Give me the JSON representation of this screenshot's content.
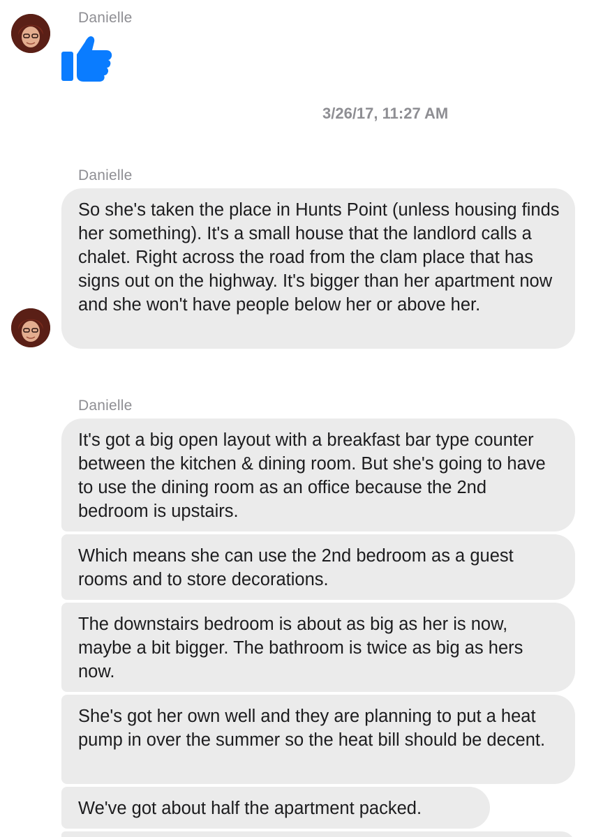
{
  "thread": {
    "sender_name": "Danielle",
    "timestamp": "3/26/17, 11:27 AM",
    "groups": [
      {
        "sender": "Danielle",
        "messages": [
          {
            "type": "like",
            "icon": "thumbs-up-icon"
          }
        ]
      },
      {
        "sender": "Danielle",
        "messages": [
          {
            "type": "text",
            "text": "So she's taken the place in Hunts Point (unless housing finds her something). It's a small house that the landlord calls a chalet. Right across the road from the clam place that has signs out on the highway. It's bigger than her apartment now and she won't have people below her or above her."
          }
        ]
      },
      {
        "sender": "Danielle",
        "messages": [
          {
            "type": "text",
            "text": "It's got a big open layout with a breakfast bar type counter between the kitchen & dining room. But she's going to have to use the dining room as an office because the 2nd bedroom is upstairs."
          },
          {
            "type": "text",
            "text": "Which means she can use the 2nd bedroom as a guest rooms and to store decorations."
          },
          {
            "type": "text",
            "text": "The downstairs bedroom is about as big as her is now, maybe a bit bigger. The bathroom is twice as big as hers now."
          },
          {
            "type": "text",
            "text": "She's got her own well and they are planning to put a heat pump in over the summer so the heat bill should be decent."
          },
          {
            "type": "text",
            "text": "We've got about half the apartment packed."
          }
        ]
      }
    ]
  },
  "colors": {
    "like_blue": "#0a7cff",
    "bubble_bg": "#ebebeb",
    "meta_text": "#8e8e93"
  }
}
